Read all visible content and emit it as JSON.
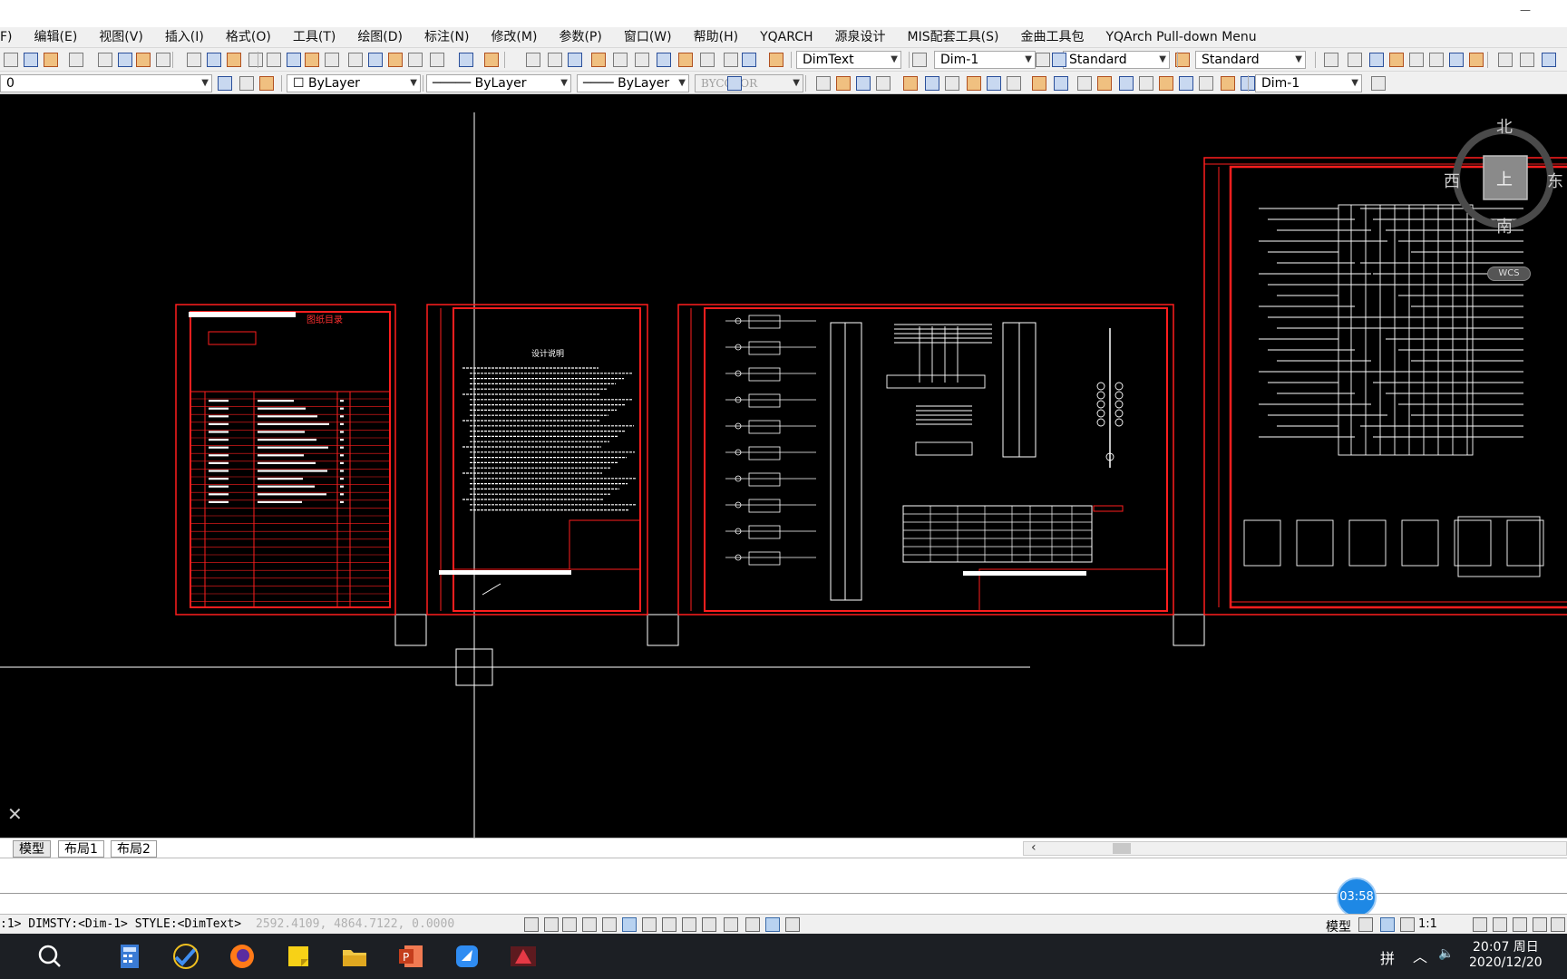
{
  "menubar": {
    "items": [
      "F)",
      "编辑(E)",
      "视图(V)",
      "插入(I)",
      "格式(O)",
      "工具(T)",
      "绘图(D)",
      "标注(N)",
      "修改(M)",
      "参数(P)",
      "窗口(W)",
      "帮助(H)",
      "YQARCH",
      "源泉设计",
      "MIS配套工具(S)",
      "金曲工具包",
      "YQArch Pull-down Menu"
    ]
  },
  "window": {
    "minimize_label": "—"
  },
  "toolbar1": {
    "text_style": "DimText",
    "dim_style": "Dim-1",
    "table_style": "Standard",
    "multileader_style": "Standard"
  },
  "toolbar2": {
    "layer": "0",
    "color": "ByLayer",
    "linetype": "ByLayer",
    "lineweight": "ByLayer",
    "plotstyle": "BYCOLOR",
    "dim_style": "Dim-1"
  },
  "drawing": {
    "index_title": "图纸目录",
    "notes_title": "设计说明",
    "viewcube": {
      "north": "北",
      "south": "南",
      "east": "东",
      "west": "西",
      "top": "上",
      "wcs": "WCS"
    }
  },
  "tabs": {
    "model": "模型",
    "layout1": "布局1",
    "layout2": "布局2"
  },
  "command": {
    "timer": "03:58"
  },
  "status": {
    "text": ":1> DIMSTY:<Dim-1> STYLE:<DimText>",
    "coords": "2592.4109,  4864.7122,  0.0000",
    "model": "模型",
    "scale": "1:1"
  },
  "taskbar": {
    "ime": "拼",
    "time": "20:07 周日",
    "date": "2020/12/20"
  },
  "colors": {
    "canvas": "#000000",
    "frame": "#ff1e1e",
    "line": "#ffffff",
    "accent": "#1e88e5"
  }
}
